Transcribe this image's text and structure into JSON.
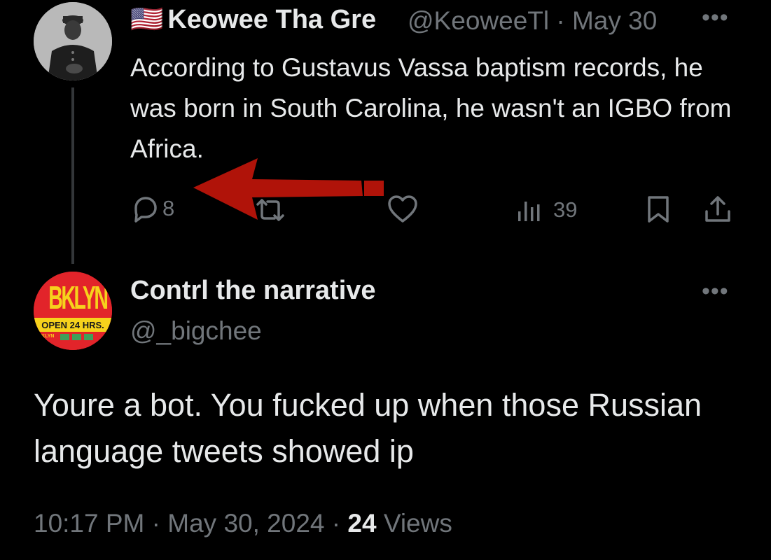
{
  "parent_tweet": {
    "flag": "🇺🇸",
    "display_name": "Keowee Tha Gre",
    "handle": "@KeoweeTl",
    "date": "May 30",
    "text": "According to Gustavus Vassa baptism records, he was born in South Carolina, he wasn't an IGBO from Africa.",
    "reply_count": "8",
    "view_count": "39"
  },
  "reply_tweet": {
    "display_name": "Contrl the narrative",
    "handle": "@_bigchee",
    "avatar_text": {
      "top": "BKLYN",
      "middle": "OPEN 24 HRS.",
      "bottom": "BKLYN"
    },
    "text": "Youre a bot.  You fucked up when those Russian language tweets showed ip",
    "time": "10:17 PM",
    "separator": "·",
    "date": "May 30, 2024",
    "view_count": "24",
    "views_label": "Views"
  },
  "icons": [
    "more-icon",
    "reply-icon",
    "retweet-icon",
    "like-icon",
    "views-icon",
    "bookmark-icon",
    "share-icon",
    "red-arrow-annotation"
  ],
  "colors": {
    "background": "#000000",
    "text": "#e7e9ea",
    "muted": "#71767b",
    "arrow": "#b01309",
    "thread_line": "#333639"
  }
}
